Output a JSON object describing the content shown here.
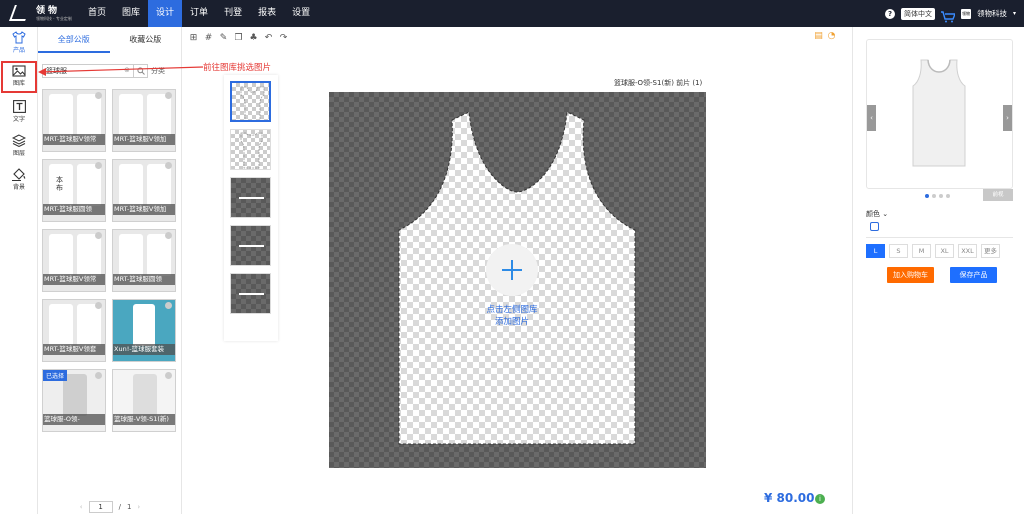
{
  "brand": {
    "name": "领物",
    "tagline": "领物科技 · 专业定制"
  },
  "nav": {
    "items": [
      "首页",
      "图库",
      "设计",
      "订单",
      "刊登",
      "报表",
      "设置"
    ],
    "active_index": 2
  },
  "topbar": {
    "help_icon": "?",
    "lang": "简体中文",
    "org_logo": "领物",
    "org_name": "领物科技"
  },
  "sidebar": {
    "items": [
      {
        "label": "产品",
        "icon": "shirt-icon"
      },
      {
        "label": "图库",
        "icon": "image-icon"
      },
      {
        "label": "文字",
        "icon": "text-icon"
      },
      {
        "label": "图层",
        "icon": "layers-icon"
      },
      {
        "label": "背景",
        "icon": "paint-bucket-icon"
      }
    ]
  },
  "panel": {
    "tabs": [
      "全部公版",
      "收藏公版"
    ],
    "search_value": "篮球服",
    "category_label": "分类",
    "cards": [
      {
        "caption": "MRT-篮球服V领常"
      },
      {
        "caption": "MRT-篮球服V领加"
      },
      {
        "caption": "MRT-篮球服圆领"
      },
      {
        "caption": "MRT-篮球服V领加"
      },
      {
        "caption": "MRT-篮球服V领常"
      },
      {
        "caption": "MRT-篮球服圆领"
      },
      {
        "caption": "MRT-篮球服V领套"
      },
      {
        "caption": "Xun!-篮球服套装"
      },
      {
        "caption": "篮球服-O领-",
        "badge": "已选择"
      },
      {
        "caption": "篮球服-V领-S1(新)"
      }
    ],
    "card_overlay_text": "本布",
    "pager": {
      "prev": "‹",
      "current": "1",
      "separator": "/",
      "total": "1",
      "next": "›"
    }
  },
  "annotation": {
    "text": "前往图库挑选图片",
    "color": "#e53935"
  },
  "canvas": {
    "label": "篮球服-O领-S1(新) 前片 (1)",
    "hint_line1": "点击左侧图库",
    "hint_line2": "添加图片"
  },
  "price": {
    "value": "¥ 80.00",
    "info_icon": "i"
  },
  "right": {
    "preview_tag": "前视",
    "color_label": "颜色",
    "sizes": [
      "L",
      "S",
      "M",
      "XL",
      "XXL",
      "更多"
    ],
    "active_size": "L",
    "add_to_cart": "加入购物车",
    "save_product": "保存产品"
  },
  "colors": {
    "accent": "#2d6cdf",
    "topbar": "#1a1f2e",
    "cart_button": "#ff6a00",
    "save_button": "#1e6fff",
    "annotation": "#e53935"
  }
}
